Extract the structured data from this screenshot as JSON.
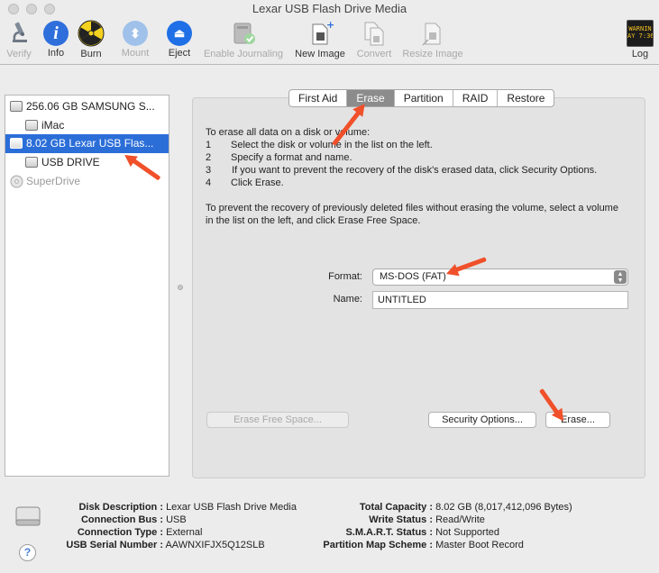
{
  "window": {
    "title": "Lexar USB Flash Drive Media"
  },
  "toolbar": {
    "verify": "Verify",
    "info": "Info",
    "burn": "Burn",
    "mount": "Mount",
    "eject": "Eject",
    "enable_journaling": "Enable Journaling",
    "new_image": "New Image",
    "convert": "Convert",
    "resize_image": "Resize Image",
    "log": "Log",
    "log_icon_text": "WARNIN\nAY 7:36"
  },
  "sidebar": {
    "items": [
      {
        "label": "256.06 GB SAMSUNG S..."
      },
      {
        "label": "iMac"
      },
      {
        "label": "8.02 GB Lexar USB Flas..."
      },
      {
        "label": "USB DRIVE"
      },
      {
        "label": "SuperDrive"
      }
    ]
  },
  "tabs": [
    "First Aid",
    "Erase",
    "Partition",
    "RAID",
    "Restore"
  ],
  "active_tab": "Erase",
  "instructions": {
    "intro": "To erase all data on a disk or volume:",
    "steps": [
      {
        "num": "1",
        "text": "Select the disk or volume in the list on the left."
      },
      {
        "num": "2",
        "text": "Specify a format and name."
      },
      {
        "num": "3",
        "text": "If you want to prevent the recovery of the disk's erased data, click Security Options."
      },
      {
        "num": "4",
        "text": "Click Erase."
      }
    ],
    "free_space": "To prevent the recovery of previously deleted files without erasing the volume, select a volume in the list on the left, and click Erase Free Space."
  },
  "form": {
    "format_label": "Format:",
    "format_value": "MS-DOS (FAT)",
    "name_label": "Name:",
    "name_value": "UNTITLED"
  },
  "buttons": {
    "erase_free_space": "Erase Free Space...",
    "security_options": "Security Options...",
    "erase": "Erase..."
  },
  "info": {
    "disk_description_label": "Disk Description :",
    "disk_description": "Lexar USB Flash Drive Media",
    "connection_bus_label": "Connection Bus :",
    "connection_bus": "USB",
    "connection_type_label": "Connection Type :",
    "connection_type": "External",
    "usb_serial_label": "USB Serial Number :",
    "usb_serial": "AAWNXIFJX5Q12SLB",
    "total_capacity_label": "Total Capacity :",
    "total_capacity": "8.02 GB (8,017,412,096 Bytes)",
    "write_status_label": "Write Status :",
    "write_status": "Read/Write",
    "smart_status_label": "S.M.A.R.T. Status :",
    "smart_status": "Not Supported",
    "partition_map_label": "Partition Map Scheme :",
    "partition_map": "Master Boot Record"
  },
  "help": {
    "label": "?"
  },
  "colors": {
    "selection": "#2b6ed8",
    "annotation_arrow": "#f0502a",
    "info_blue": "#2f6fdc",
    "eject_blue": "#1f70e6"
  }
}
